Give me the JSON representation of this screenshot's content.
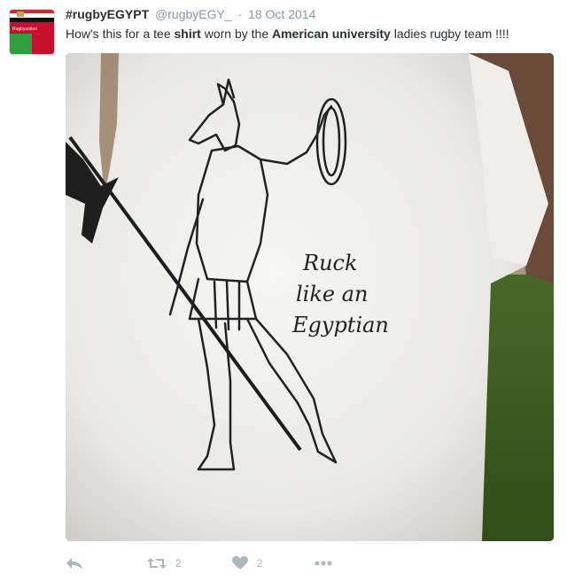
{
  "tweet": {
    "fullname": "#rugbyEGYPT",
    "username": "@rugbyEGY_",
    "separator": "·",
    "timestamp": "18 Oct 2014",
    "text": {
      "p1": "How's this for a tee ",
      "b1": "shirt",
      "p2": " worn by the ",
      "b2": "American university",
      "p3": " ladies rugby team !!!!"
    }
  },
  "avatar": {
    "label": "Rugbyunited"
  },
  "media": {
    "shirt_text_line1": "Ruck",
    "shirt_text_line2": "like an",
    "shirt_text_line3": "Egyptian"
  },
  "actions": {
    "reply_icon": "reply-icon",
    "retweet_icon": "retweet-icon",
    "retweet_count": "2",
    "like_icon": "heart-icon",
    "like_count": "2",
    "more_icon": "more-dots-icon"
  },
  "colors": {
    "muted": "#8899a6",
    "action": "#aab8c2",
    "text": "#292f33"
  }
}
